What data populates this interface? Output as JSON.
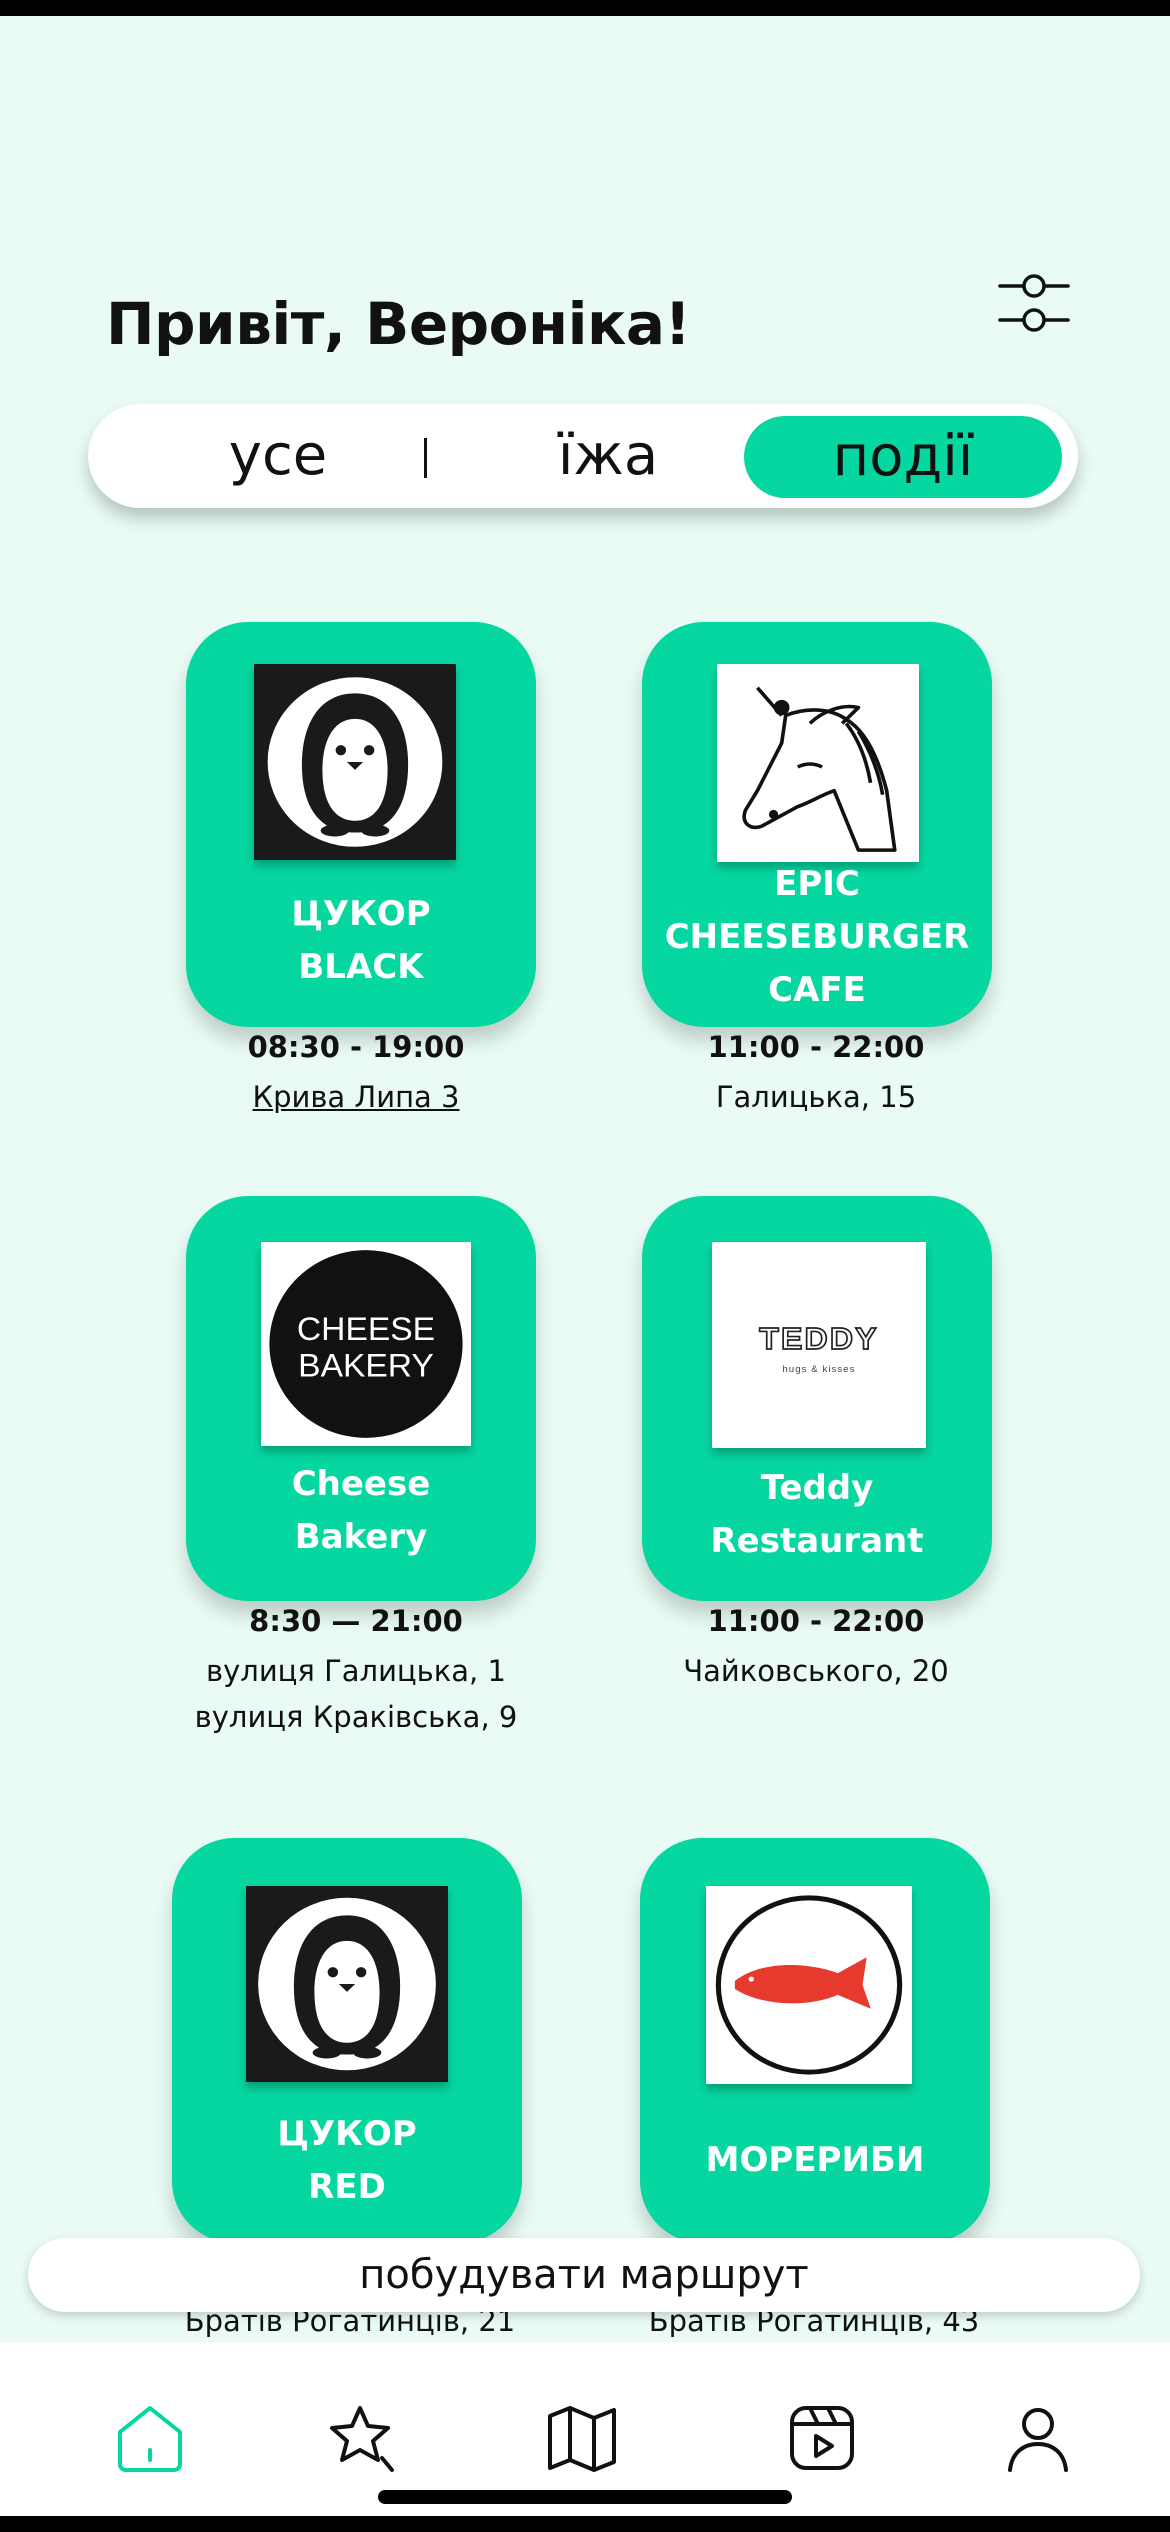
{
  "header": {
    "greeting": "Привіт, Вероніка!",
    "filter_icon": "sliders-icon"
  },
  "segments": {
    "all": "усе",
    "food": "їжа",
    "events": "події",
    "active": "події"
  },
  "places": [
    {
      "name_lines": [
        "ЦУКОР",
        "BLACK"
      ],
      "hours": "08:30 - 19:00",
      "address_lines": [
        "Крива Липа 3"
      ],
      "logo": "penguin-logo"
    },
    {
      "name_lines": [
        "EPIC",
        "CHEESEBURGER",
        "CAFE"
      ],
      "hours": "11:00 - 22:00",
      "address_lines": [
        "Галицька, 15"
      ],
      "logo": "unicorn-logo"
    },
    {
      "name_lines": [
        "Cheese",
        "Bakery"
      ],
      "hours": "8:30 — 21:00",
      "address_lines": [
        "вулиця Галицька, 1",
        "вулиця Краківська, 9"
      ],
      "logo": "cheese-bakery-logo",
      "logo_text": [
        "CHEESE",
        "BAKERY"
      ]
    },
    {
      "name_lines": [
        "Teddy",
        "Restaurant"
      ],
      "hours": "11:00 - 22:00",
      "address_lines": [
        "Чайковського, 20"
      ],
      "logo": "teddy-logo",
      "logo_text": [
        "TEDDY",
        "hugs & kisses"
      ]
    },
    {
      "name_lines": [
        "ЦУКОР",
        "RED"
      ],
      "address_lines": [
        "Братів Рогатинців, 21"
      ],
      "logo": "penguin-logo"
    },
    {
      "name_lines": [
        "МОРЕРИБИ"
      ],
      "address_lines": [
        "Братів Рогатинців, 43"
      ],
      "logo": "fish-logo"
    }
  ],
  "route_button": "побудувати маршрут",
  "tabs": [
    "home-icon",
    "star-icon",
    "map-icon",
    "video-icon",
    "profile-icon"
  ],
  "colors": {
    "accent": "#06d6a0",
    "background": "#e9fbf4"
  }
}
